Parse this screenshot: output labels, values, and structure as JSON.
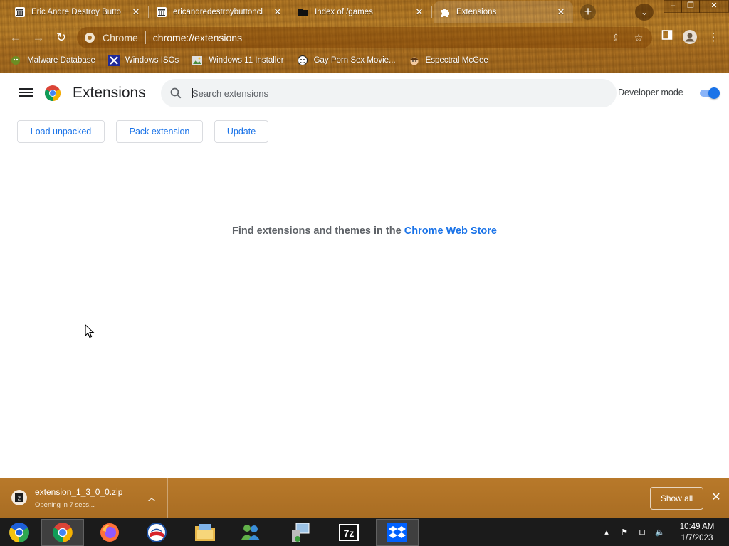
{
  "browser": {
    "tabs": [
      {
        "title": "Eric Andre Destroy Butto",
        "icon": "archive-building-icon",
        "active": false
      },
      {
        "title": "ericandredestroybuttoncl",
        "icon": "archive-building-icon",
        "active": false
      },
      {
        "title": "Index of /games",
        "icon": "folder-icon",
        "active": false
      },
      {
        "title": "Extensions",
        "icon": "puzzle-icon",
        "active": true
      }
    ],
    "omnibox": {
      "chip_label": "Chrome",
      "url": "chrome://extensions"
    },
    "bookmarks": [
      {
        "label": "Malware Database",
        "icon": "malware-icon"
      },
      {
        "label": "Windows ISOs",
        "icon": "x-logo-icon"
      },
      {
        "label": "Windows 11 Installer",
        "icon": "image-thumb-icon"
      },
      {
        "label": "Gay Porn Sex Movie...",
        "icon": "cartoon-face-icon"
      },
      {
        "label": "Espectral McGee",
        "icon": "cartoon-face-icon"
      }
    ],
    "theme_color": "#b47a26"
  },
  "extensions": {
    "title": "Extensions",
    "search_placeholder": "Search extensions",
    "developer_mode_label": "Developer mode",
    "developer_mode_on": true,
    "buttons": {
      "load_unpacked": "Load unpacked",
      "pack_extension": "Pack extension",
      "update": "Update"
    },
    "empty_text": "Find extensions and themes in the",
    "store_link": "Chrome Web Store",
    "accent_color": "#1a73e8"
  },
  "download": {
    "filename": "extension_1_3_0_0.zip",
    "status": "Opening in 7 secs...",
    "show_all": "Show all"
  },
  "taskbar": {
    "apps": [
      "chrome-os-logo-icon",
      "chrome-icon",
      "firefox-icon",
      "obama-logo-icon",
      "file-explorer-icon",
      "windows-live-messenger-icon",
      "network-share-icon",
      "7zip-icon",
      "dropbox-icon"
    ],
    "time": "10:49 AM",
    "date": "1/7/2023"
  }
}
